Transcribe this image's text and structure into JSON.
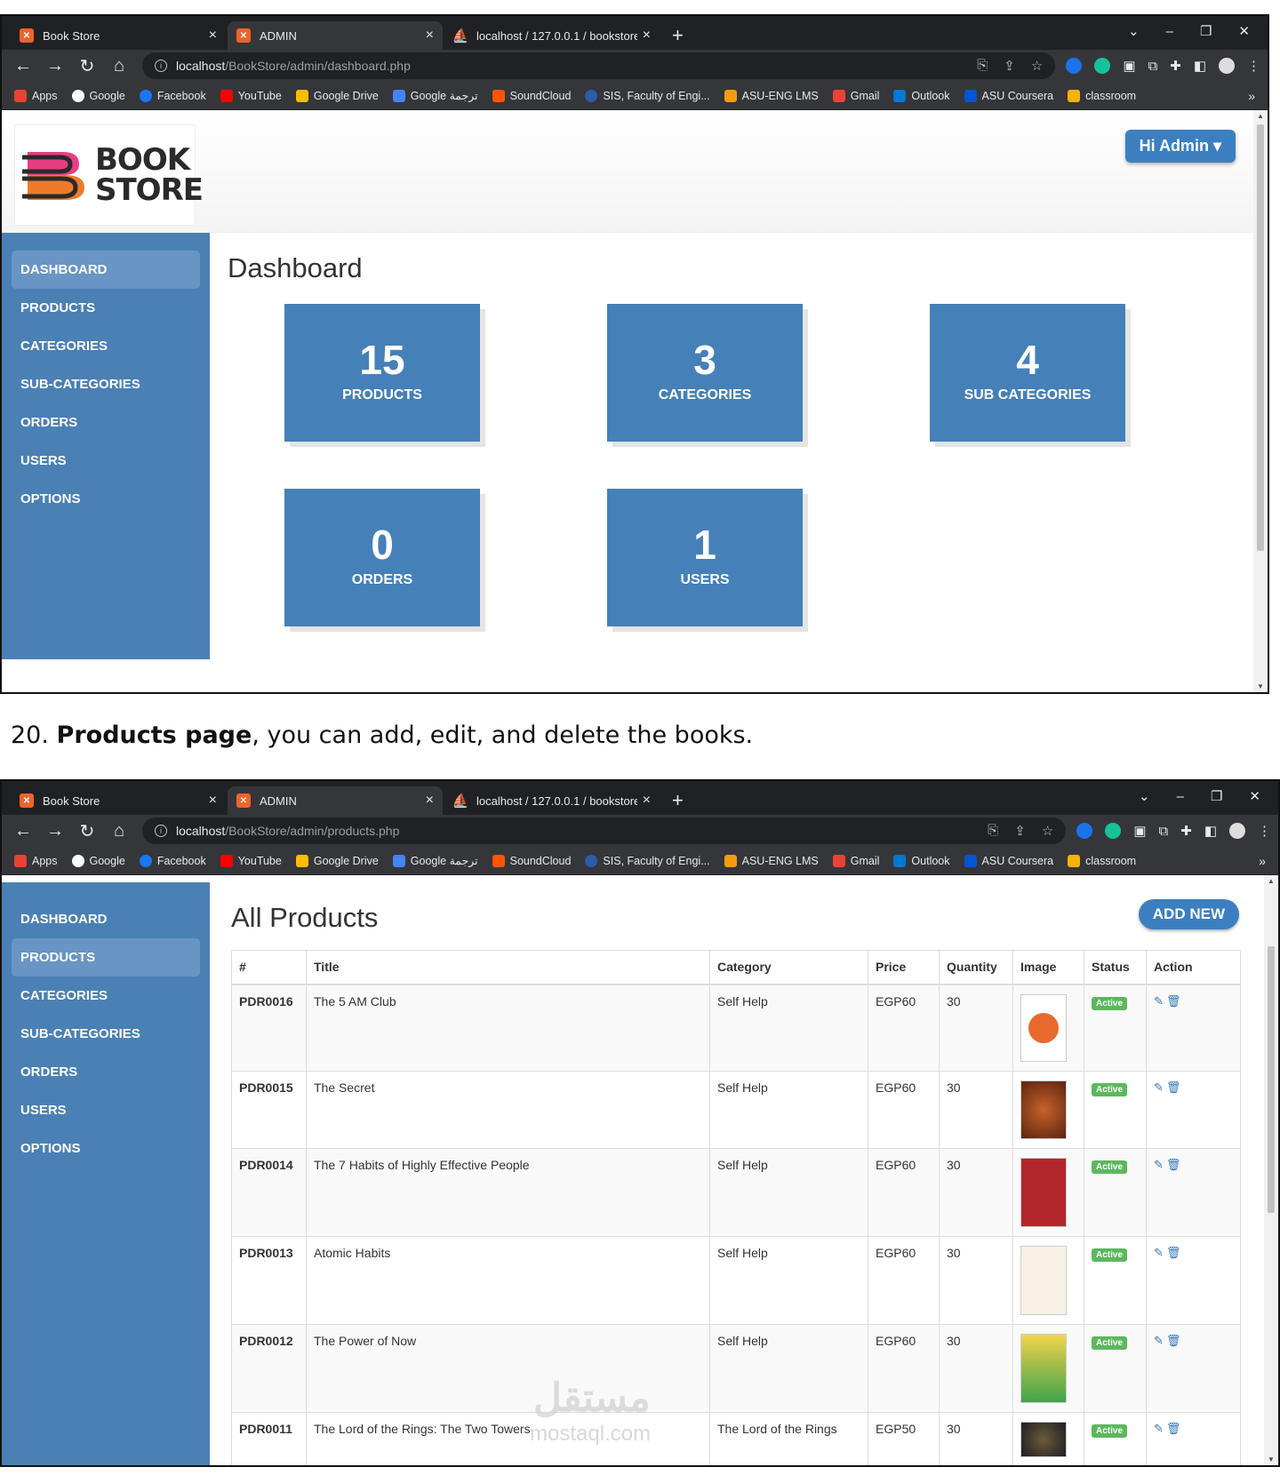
{
  "browser1": {
    "tabs": [
      {
        "title": "Book Store",
        "icon": "xampp-icon"
      },
      {
        "title": "ADMIN",
        "icon": "xampp-icon"
      },
      {
        "title": "localhost / 127.0.0.1 / bookstore",
        "icon": "phpmyadmin-icon"
      }
    ],
    "url_host": "localhost",
    "url_path": "/BookStore/admin/dashboard.php"
  },
  "browser2": {
    "tabs": [
      {
        "title": "Book Store",
        "icon": "xampp-icon"
      },
      {
        "title": "ADMIN",
        "icon": "xampp-icon"
      },
      {
        "title": "localhost / 127.0.0.1 / bookstore",
        "icon": "phpmyadmin-icon"
      }
    ],
    "url_host": "localhost",
    "url_path": "/BookStore/admin/products.php"
  },
  "bookmarks": [
    {
      "label": "Apps",
      "color": "#e94235"
    },
    {
      "label": "Google",
      "color": "#ffffff"
    },
    {
      "label": "Facebook",
      "color": "#1877f2"
    },
    {
      "label": "YouTube",
      "color": "#ff0000"
    },
    {
      "label": "Google Drive",
      "color": "#fbbc04"
    },
    {
      "label": "Google ترجمة",
      "color": "#4285f4"
    },
    {
      "label": "SoundCloud",
      "color": "#ff5500"
    },
    {
      "label": "SIS, Faculty of Engi...",
      "color": "#2a5caa"
    },
    {
      "label": "ASU-ENG LMS",
      "color": "#f39c12"
    },
    {
      "label": "Gmail",
      "color": "#ea4335"
    },
    {
      "label": "Outlook",
      "color": "#0078d4"
    },
    {
      "label": "ASU Coursera",
      "color": "#0056d2"
    },
    {
      "label": "classroom",
      "color": "#f4b400"
    }
  ],
  "logo": {
    "line1": "BOOK",
    "line2": "STORE"
  },
  "user_menu": "Hi Admin",
  "sidebar": [
    "DASHBOARD",
    "PRODUCTS",
    "CATEGORIES",
    "SUB-CATEGORIES",
    "ORDERS",
    "USERS",
    "OPTIONS"
  ],
  "dashboard": {
    "title": "Dashboard",
    "cards": [
      {
        "value": "15",
        "label": "PRODUCTS"
      },
      {
        "value": "3",
        "label": "CATEGORIES"
      },
      {
        "value": "4",
        "label": "SUB CATEGORIES"
      },
      {
        "value": "0",
        "label": "ORDERS"
      },
      {
        "value": "1",
        "label": "USERS"
      }
    ]
  },
  "caption": {
    "num": "20.",
    "bold": "Products page",
    "rest": ", you can add, edit, and delete the books."
  },
  "products": {
    "title": "All Products",
    "add_label": "ADD NEW",
    "columns": [
      "#",
      "Title",
      "Category",
      "Price",
      "Quantity",
      "Image",
      "Status",
      "Action"
    ],
    "rows": [
      {
        "id": "PDR0016",
        "title": "The 5 AM Club",
        "category": "Self Help",
        "price": "EGP60",
        "qty": "30",
        "status": "Active"
      },
      {
        "id": "PDR0015",
        "title": "The Secret",
        "category": "Self Help",
        "price": "EGP60",
        "qty": "30",
        "status": "Active"
      },
      {
        "id": "PDR0014",
        "title": "The 7 Habits of Highly Effective People",
        "category": "Self Help",
        "price": "EGP60",
        "qty": "30",
        "status": "Active"
      },
      {
        "id": "PDR0013",
        "title": "Atomic Habits",
        "category": "Self Help",
        "price": "EGP60",
        "qty": "30",
        "status": "Active"
      },
      {
        "id": "PDR0012",
        "title": "The Power of Now",
        "category": "Self Help",
        "price": "EGP60",
        "qty": "30",
        "status": "Active"
      },
      {
        "id": "PDR0011",
        "title": "The Lord of the Rings: The Two Towers",
        "category": "The Lord of the Rings",
        "price": "EGP50",
        "qty": "30",
        "status": "Active"
      }
    ]
  },
  "colors": {
    "sidebar": "#4a80b4",
    "card": "#4680b8",
    "button": "#3c7fc0",
    "active": "#5cb85c"
  },
  "watermark": {
    "arabic": "مستقل",
    "latin": "mostaql.com"
  }
}
